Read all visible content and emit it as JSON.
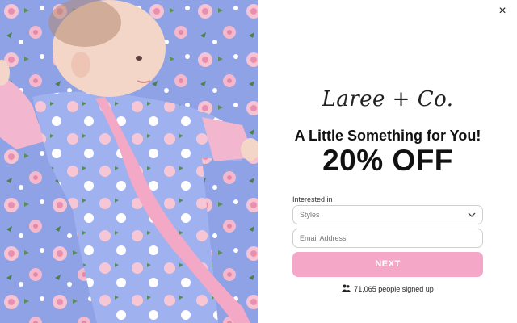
{
  "popup": {
    "close_symbol": "×",
    "logo_text": "Laree + Co.",
    "headline": "A Little Something for You!",
    "offer": "20% OFF",
    "interest_label": "Interested in",
    "select_value": "Styles",
    "email_placeholder": "Email Address",
    "next_label": "NEXT",
    "signed_up_text": "71,065 people signed up",
    "accent_color": "#f4a7c7"
  },
  "image": {
    "subject": "baby in blue floral footie with pink ruffle lying on floral blanket"
  }
}
